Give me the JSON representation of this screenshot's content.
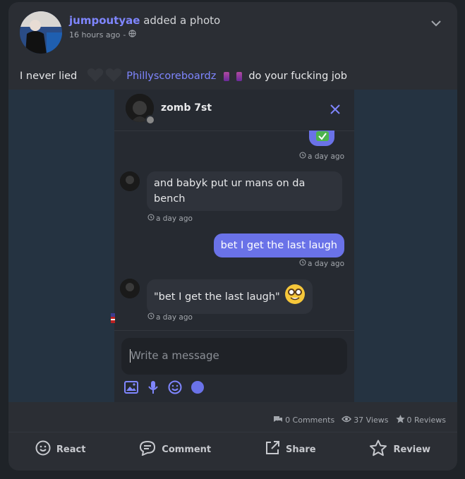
{
  "post": {
    "author": "jumpoutyae",
    "action": "added a photo",
    "time": "16 hours ago",
    "caption_start": "I never lied",
    "mention": "Phillyscoreboardz",
    "caption_end": "do your fucking job"
  },
  "chat": {
    "name": "zomb 7st",
    "messages": [
      {
        "text": "and babyk put ur mans on da bench",
        "time": "a day ago",
        "dir": "in"
      },
      {
        "text": "bet I get the last laugh",
        "time": "a day ago",
        "dir": "out"
      },
      {
        "text": "\"bet I get the last laugh\"",
        "time": "a day ago",
        "dir": "in"
      }
    ],
    "top_time": "a day ago",
    "composer_placeholder": "Write a message"
  },
  "stats": {
    "comments": "0 Comments",
    "views": "37 Views",
    "reviews": "0 Reviews"
  },
  "actions": {
    "react": "React",
    "comment": "Comment",
    "share": "Share",
    "review": "Review"
  },
  "colors": {
    "accent": "#7f86ff",
    "bubble_out": "#6a72e8",
    "card": "#2b2e34"
  }
}
